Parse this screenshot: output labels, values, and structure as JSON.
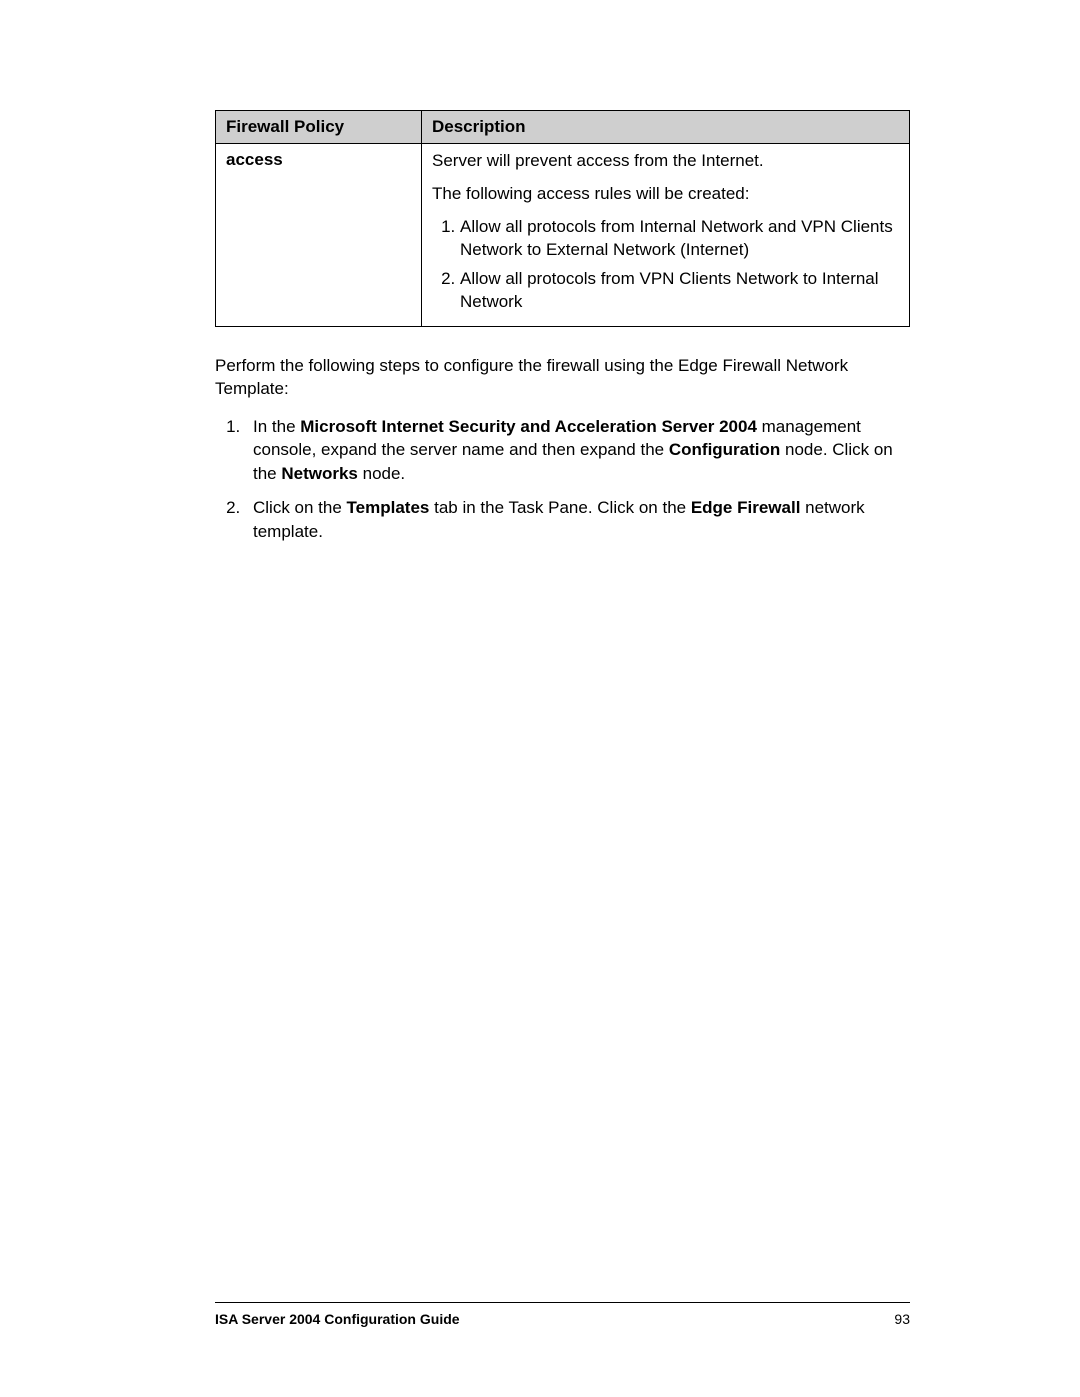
{
  "table": {
    "header_left": "Firewall Policy",
    "header_right": "Description",
    "row_left": "access",
    "desc_p1": "Server will prevent access from the Internet.",
    "desc_p2": "The following access rules will be created:",
    "rules": [
      "Allow all protocols from Internal Network and VPN Clients Network to External Network (Internet)",
      "Allow all protocols from VPN Clients Network to Internal Network"
    ]
  },
  "intro": "Perform the following steps to configure the firewall using the Edge Firewall Network Template:",
  "steps": {
    "s1": {
      "pre": "In the ",
      "b1": "Microsoft Internet Security and Acceleration Server 2004",
      "mid1": " management console, expand the server name and then expand the ",
      "b2": "Configuration",
      "mid2": " node. Click on the ",
      "b3": "Networks",
      "post": " node."
    },
    "s2": {
      "pre": "Click on the ",
      "b1": "Templates",
      "mid1": " tab in the Task Pane. Click on the ",
      "b2": "Edge Firewall",
      "post": " network template."
    }
  },
  "footer": {
    "title": "ISA Server 2004 Configuration Guide",
    "page": "93"
  }
}
